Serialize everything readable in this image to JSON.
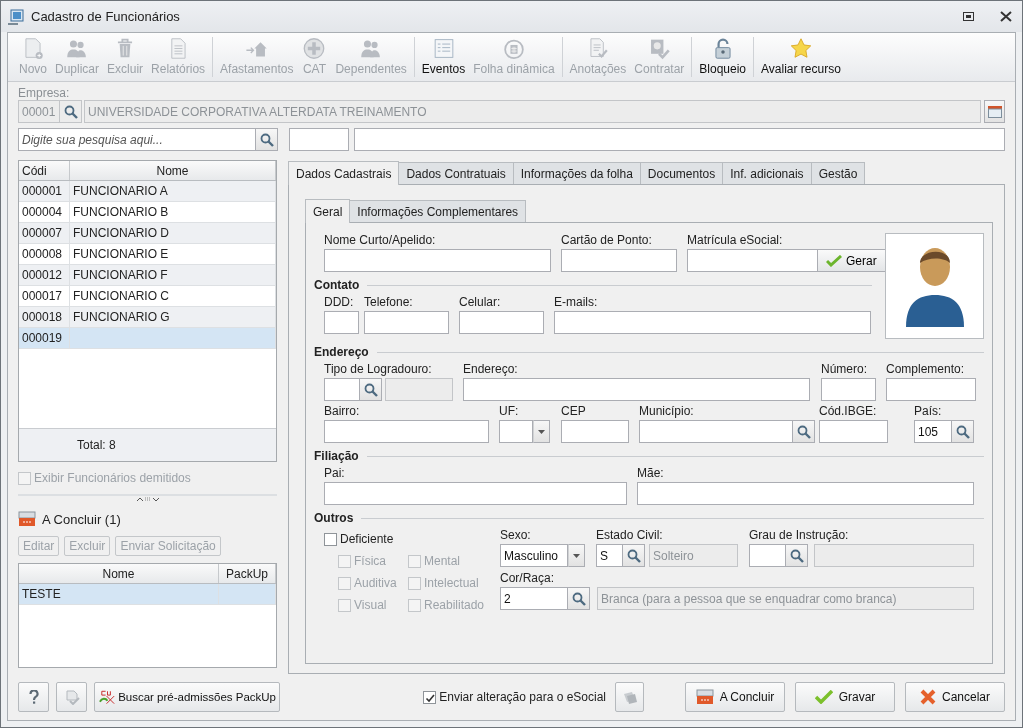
{
  "window": {
    "title": "Cadastro de Funcionários"
  },
  "toolbar": [
    [
      {
        "label": "Novo",
        "kind": "new",
        "disabled": true
      },
      {
        "label": "Duplicar",
        "kind": "duplicate",
        "disabled": true
      },
      {
        "label": "Excluir",
        "kind": "delete",
        "disabled": true
      },
      {
        "label": "Relatórios",
        "kind": "report",
        "disabled": true
      }
    ],
    [
      {
        "label": "Afastamentos",
        "kind": "leave",
        "disabled": true
      },
      {
        "label": "CAT",
        "kind": "cat",
        "disabled": true
      },
      {
        "label": "Dependentes",
        "kind": "dependents",
        "disabled": true
      }
    ],
    [
      {
        "label": "Eventos",
        "kind": "events",
        "disabled": false
      },
      {
        "label": "Folha dinâmica",
        "kind": "payroll",
        "disabled": true
      }
    ],
    [
      {
        "label": "Anotações",
        "kind": "notes",
        "disabled": true
      },
      {
        "label": "Contratar",
        "kind": "hire",
        "disabled": true
      }
    ],
    [
      {
        "label": "Bloqueio",
        "kind": "lock",
        "disabled": false
      }
    ],
    [
      {
        "label": "Avaliar recurso",
        "kind": "star",
        "disabled": false
      }
    ]
  ],
  "empresa": {
    "label": "Empresa:",
    "code": "00001",
    "name": "UNIVERSIDADE CORPORATIVA ALTERDATA TREINAMENTO"
  },
  "search": {
    "placeholder": "Digite sua pesquisa aqui..."
  },
  "employees": {
    "columns": [
      "Códi",
      "Nome"
    ],
    "rows": [
      {
        "code": "000001",
        "name": "FUNCIONARIO A",
        "selected": false
      },
      {
        "code": "000004",
        "name": "FUNCIONARIO B",
        "selected": false
      },
      {
        "code": "000007",
        "name": "FUNCIONARIO D",
        "selected": false
      },
      {
        "code": "000008",
        "name": "FUNCIONARIO E",
        "selected": false
      },
      {
        "code": "000012",
        "name": "FUNCIONARIO F",
        "selected": false
      },
      {
        "code": "000017",
        "name": "FUNCIONARIO C",
        "selected": false
      },
      {
        "code": "000018",
        "name": "FUNCIONARIO G",
        "selected": false
      },
      {
        "code": "000019",
        "name": "",
        "selected": true
      }
    ],
    "total": "Total: 8"
  },
  "show_dismissed": {
    "label": "Exibir Funcionários demitidos",
    "checked": false,
    "disabled": true
  },
  "pending": {
    "title": "A Concluir (1)",
    "buttons": [
      {
        "label": "Editar",
        "disabled": true
      },
      {
        "label": "Excluir",
        "disabled": true
      },
      {
        "label": "Enviar Solicitação",
        "disabled": true
      }
    ],
    "columns": [
      "Nome",
      "PackUp"
    ],
    "rows": [
      {
        "name": "TESTE",
        "selected": true
      }
    ]
  },
  "packup_button": "Buscar pré-admissões PackUp",
  "tabs": [
    {
      "label": "Dados Cadastrais",
      "selected": true
    },
    {
      "label": "Dados Contratuais",
      "selected": false
    },
    {
      "label": "Informações da folha",
      "selected": false
    },
    {
      "label": "Documentos",
      "selected": false
    },
    {
      "label": "Inf. adicionais",
      "selected": false
    },
    {
      "label": "Gestão",
      "selected": false
    }
  ],
  "subtabs": [
    {
      "label": "Geral",
      "selected": true
    },
    {
      "label": "Informações Complementares",
      "selected": false
    }
  ],
  "geral": {
    "top_fields": [
      {
        "label": "Nome Curto/Apelido:",
        "kind": "text"
      },
      {
        "label": "Cartão de Ponto:",
        "kind": "text"
      },
      {
        "label": "Matrícula eSocial:",
        "kind": "button",
        "button": "Gerar"
      }
    ],
    "sections": [
      {
        "title": "Contato",
        "lines": [
          {
            "fields": [
              {
                "label": "DDD:",
                "kind": "text"
              },
              {
                "label": "Telefone:",
                "kind": "text"
              },
              {
                "label": "Celular:",
                "kind": "text"
              },
              {
                "label": "E-mails:",
                "kind": "text"
              }
            ]
          }
        ]
      },
      {
        "title": "Endereço",
        "lines": [
          {
            "fields": [
              {
                "label": "Tipo de Logradouro:",
                "kind": "lookup_desc"
              },
              {
                "label": "Endereço:",
                "kind": "text"
              },
              {
                "label": "Número:",
                "kind": "text"
              },
              {
                "label": "Complemento:",
                "kind": "text"
              }
            ]
          },
          {
            "fields": [
              {
                "label": "Bairro:",
                "kind": "text"
              },
              {
                "label": "UF:",
                "kind": "select"
              },
              {
                "label": "CEP",
                "kind": "text"
              },
              {
                "label": "Município:",
                "kind": "lookup"
              },
              {
                "label": "Cód.IBGE:",
                "kind": "text"
              },
              {
                "label": "País:",
                "kind": "lookup",
                "value": "105"
              }
            ]
          }
        ]
      },
      {
        "title": "Filiação",
        "lines": [
          {
            "fields": [
              {
                "label": "Pai:",
                "kind": "text"
              },
              {
                "label": "Mãe:",
                "kind": "text"
              }
            ]
          }
        ]
      }
    ],
    "outros": {
      "title": "Outros",
      "deficiente": {
        "label": "Deficiente",
        "checked": false
      },
      "deficiencias": [
        {
          "label": "Física",
          "checked": false,
          "disabled": true
        },
        {
          "label": "Mental",
          "checked": false,
          "disabled": true
        },
        {
          "label": "Auditiva",
          "checked": false,
          "disabled": true
        },
        {
          "label": "Intelectual",
          "checked": false,
          "disabled": true
        },
        {
          "label": "Visual",
          "checked": false,
          "disabled": true
        },
        {
          "label": "Reabilitado",
          "checked": false,
          "disabled": true
        }
      ],
      "fields": [
        {
          "label": "Sexo:",
          "kind": "select",
          "value": "Masculino"
        },
        {
          "label": "Estado Civil:",
          "kind": "lookup_desc",
          "value": "S",
          "description": "Solteiro"
        },
        {
          "label": "Grau de Instrução:",
          "kind": "lookup_desc"
        },
        {
          "label": "Cor/Raça:",
          "kind": "lookup_desc",
          "value": "2",
          "description": "Branca (para a pessoa que se enquadrar como branca)"
        }
      ]
    }
  },
  "esocial": {
    "label": "Enviar alteração para o eSocial",
    "checked": true
  },
  "actions": [
    {
      "label": "A Concluir",
      "kind": "pending"
    },
    {
      "label": "Gravar",
      "kind": "save"
    },
    {
      "label": "Cancelar",
      "kind": "cancel"
    }
  ]
}
